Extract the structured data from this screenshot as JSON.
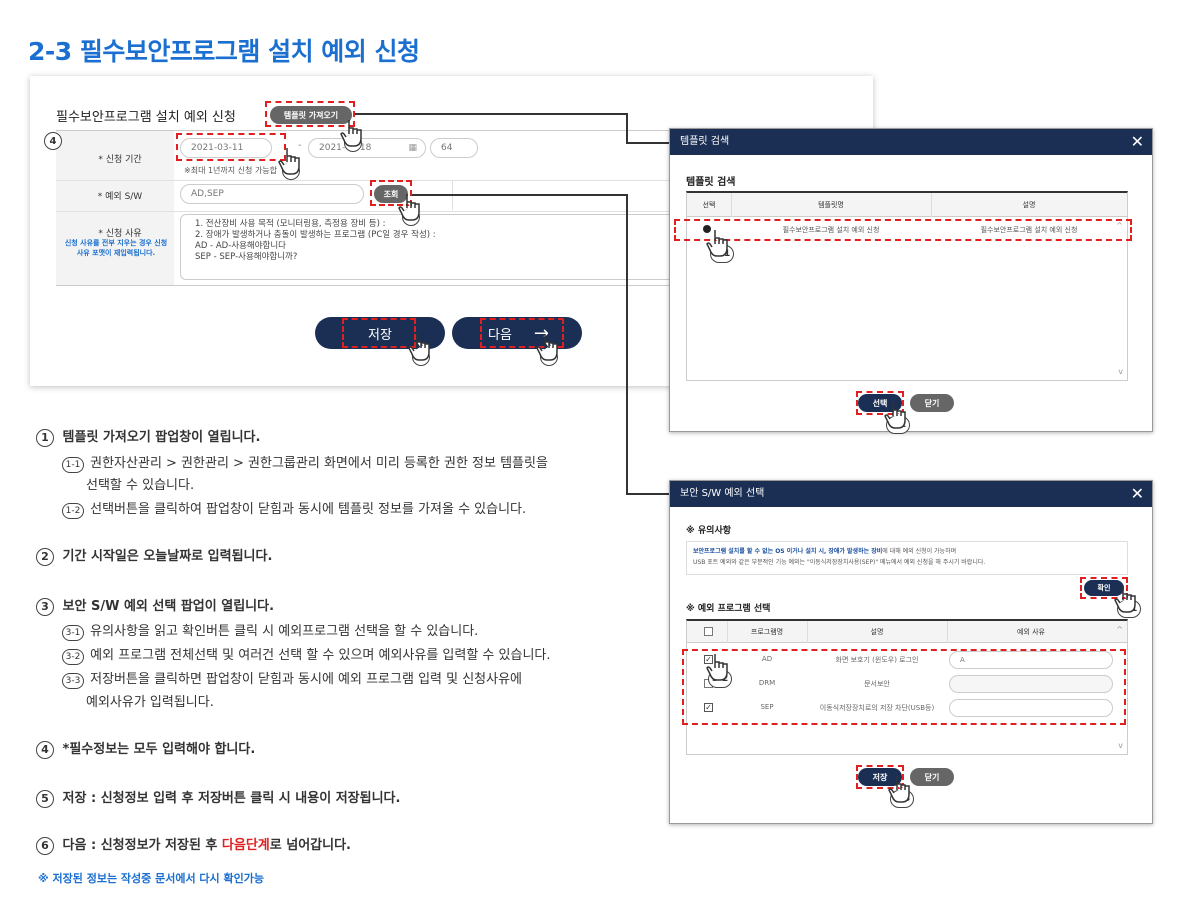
{
  "page_title": "2-3 필수보안프로그램 설치 예외 신청",
  "form": {
    "title": "필수보안프로그램 설치 예외 신청",
    "template_button": "템플릿 가져오기",
    "period_label": "* 신청 기간",
    "date_start": "2021-03-11",
    "date_end": "2021-03-18",
    "days": "64",
    "period_note": "※최대 1년까지 신청 가능합",
    "sw_label": "* 예외 S/W",
    "sw_value": "AD,SEP",
    "lookup_button": "조회",
    "reason_label": "* 신청 사유",
    "reason_note": "신청 사유를 전부 지우는 경우 신청 사유 포맷이 재입력됩니다.",
    "reason_text": [
      "1. 전산장비 사용 목적 (모니터링용, 측정용 장비 등) :",
      "2. 장애가 발생하거나 충돌이 발생하는 프로그램 (PC일 경우 작성) :",
      "AD - AD-사용해야합니다",
      "SEP - SEP-사용해야합니까?"
    ],
    "save_button": "저장",
    "next_button": "다음"
  },
  "template_popup": {
    "header": "템플릿 검색",
    "subtitle": "템플릿 검색",
    "columns": [
      "선택",
      "템플릿명",
      "설명"
    ],
    "row": {
      "name": "필수보안프로그램 설치 예외 신청",
      "desc": "필수보안프로그램 설치 예외 신청"
    },
    "select_button": "선택",
    "close_button": "닫기"
  },
  "sw_popup": {
    "header": "보안 S/W 예외 선택",
    "notice_title": "※ 유의사항",
    "notice_bold": "보안프로그램 설치를 할 수 없는 OS 이거나 설치 시, 장애가 발생하는 장비",
    "notice_rest": "에 대해 예외 신청이 가능하며",
    "notice_line2": "USB 포트 예외와 같은 부분적인 기능 예외는 \"이동식저장장치사용(SEP)\" 메뉴에서 예외 신청을 해 주시기 바랍니다.",
    "confirm_button": "확인",
    "select_title": "※ 예외 프로그램 선택",
    "columns": [
      "프로그램명",
      "설명",
      "예외 사유"
    ],
    "rows": [
      {
        "name": "AD",
        "desc": "화면 보호기 (윈도우) 로그인",
        "reason": "A",
        "checked": true
      },
      {
        "name": "DRM",
        "desc": "문서보안",
        "reason": "",
        "checked": false
      },
      {
        "name": "SEP",
        "desc": "이동식저장장치로의 저장 차단(USB등)",
        "reason": "",
        "checked": true
      }
    ],
    "save_button": "저장",
    "close_button": "닫기"
  },
  "markers": [
    "1",
    "2",
    "3",
    "4",
    "5",
    "6",
    "1-1",
    "1-2",
    "3-1",
    "3-2",
    "3-3"
  ],
  "descriptions": [
    {
      "num": "1",
      "text": "템플릿 가져오기 팝업창이 열립니다."
    },
    {
      "num": "1-1",
      "text": "권한자산관리 > 권한관리 > 권한그룹관리 화면에서 미리 등록한 권한 정보 템플릿을",
      "text2": "선택할 수 있습니다."
    },
    {
      "num": "1-2",
      "text": "선택버튼을 클릭하여 팝업창이 닫힘과 동시에 템플릿 정보를 가져올 수 있습니다."
    },
    {
      "num": "2",
      "text": "기간 시작일은 오늘날짜로 입력됩니다."
    },
    {
      "num": "3",
      "text": "보안 S/W 예외 선택 팝업이 열립니다."
    },
    {
      "num": "3-1",
      "text": "유의사항을 읽고 확인버튼 클릭 시 예외프로그램 선택을 할 수 있습니다."
    },
    {
      "num": "3-2",
      "text": "예외 프로그램 전체선택 및 여러건 선택 할 수 있으며 예외사유를 입력할 수 있습니다."
    },
    {
      "num": "3-3",
      "text": "저장버튼을 클릭하면 팝업창이 닫힘과 동시에 예외 프로그램 입력 및 신청사유에",
      "text2": "예외사유가 입력됩니다."
    },
    {
      "num": "4",
      "text": "*필수정보는 모두 입력해야 합니다."
    },
    {
      "num": "5",
      "text": "저장 : 신청정보 입력 후 저장버튼 클릭 시 내용이 저장됩니다."
    },
    {
      "num": "6",
      "text_a": "다음 : 신청정보가 저장된 후 ",
      "text_red": "다음단계",
      "text_b": "로 넘어갑니다."
    }
  ],
  "footnote": "※ 저장된 정보는 작성중 문서에서 다시 확인가능",
  "colors": {
    "navy": "#1b2f55",
    "accent_blue": "#1a6fd0",
    "red": "#e02020"
  }
}
